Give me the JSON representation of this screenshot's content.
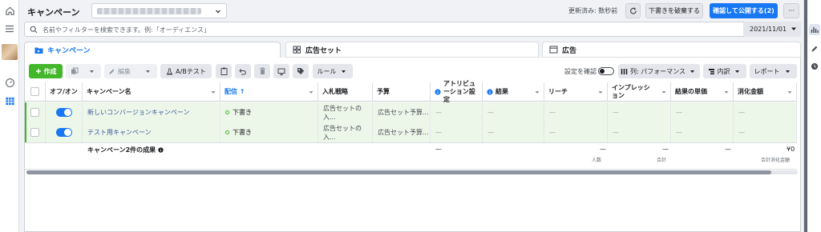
{
  "header": {
    "title": "キャンペーン",
    "updated": "更新済み: 数秒前",
    "discard_label": "下書きを破棄する",
    "publish_label": "確認して公開する(2)",
    "more_label": "···"
  },
  "search": {
    "placeholder": "名前やフィルターを検索できます。例:「オーディエンス」"
  },
  "date": {
    "value": "2021/11/01"
  },
  "tabs": [
    {
      "label": "キャンペーン"
    },
    {
      "label": "広告セット"
    },
    {
      "label": "広告"
    }
  ],
  "toolbar": {
    "create_label": "作成",
    "edit_label": "編集",
    "ab_label": "A/Bテスト",
    "rule_label": "ルール",
    "settings_check_label": "設定を確認",
    "columns_label": "列: パフォーマンス",
    "breakdown_label": "内訳",
    "report_label": "レポート"
  },
  "table": {
    "headers": {
      "onoff": "オフ/オン",
      "name": "キャンペーン名",
      "delivery": "配信 ↑",
      "bid": "入札戦略",
      "budget": "予算",
      "attribution": "アトリビュ ーション設定",
      "results": "結果",
      "reach": "リーチ",
      "impressions": "インプレッシ ョン",
      "cost_per_result": "結果の単価",
      "spend": "消化金額"
    },
    "rows": [
      {
        "name": "新しいコンバージョンキャンペーン",
        "delivery": "下書き",
        "bid": "広告セットの入...",
        "budget": "広告セット予算...",
        "attribution": "—",
        "results": "—",
        "reach": "—",
        "impressions": "—",
        "cpr": "—",
        "spend": "—"
      },
      {
        "name": "テスト用キャンペーン",
        "delivery": "下書き",
        "bid": "広告セットの入...",
        "budget": "広告セット予算...",
        "attribution": "—",
        "results": "—",
        "reach": "—",
        "impressions": "—",
        "cpr": "—",
        "spend": "—"
      }
    ],
    "totals": {
      "label": "キャンペーン2件の成果",
      "attribution": "—",
      "reach": "—",
      "reach_sub": "人数",
      "impressions": "—",
      "impressions_sub": "合計",
      "cpr": "—",
      "spend": "¥0",
      "spend_sub": "合計消化金額"
    }
  },
  "colors": {
    "accent": "#1877f2",
    "create": "#42b72a",
    "row_bg": "#edf7e9"
  }
}
